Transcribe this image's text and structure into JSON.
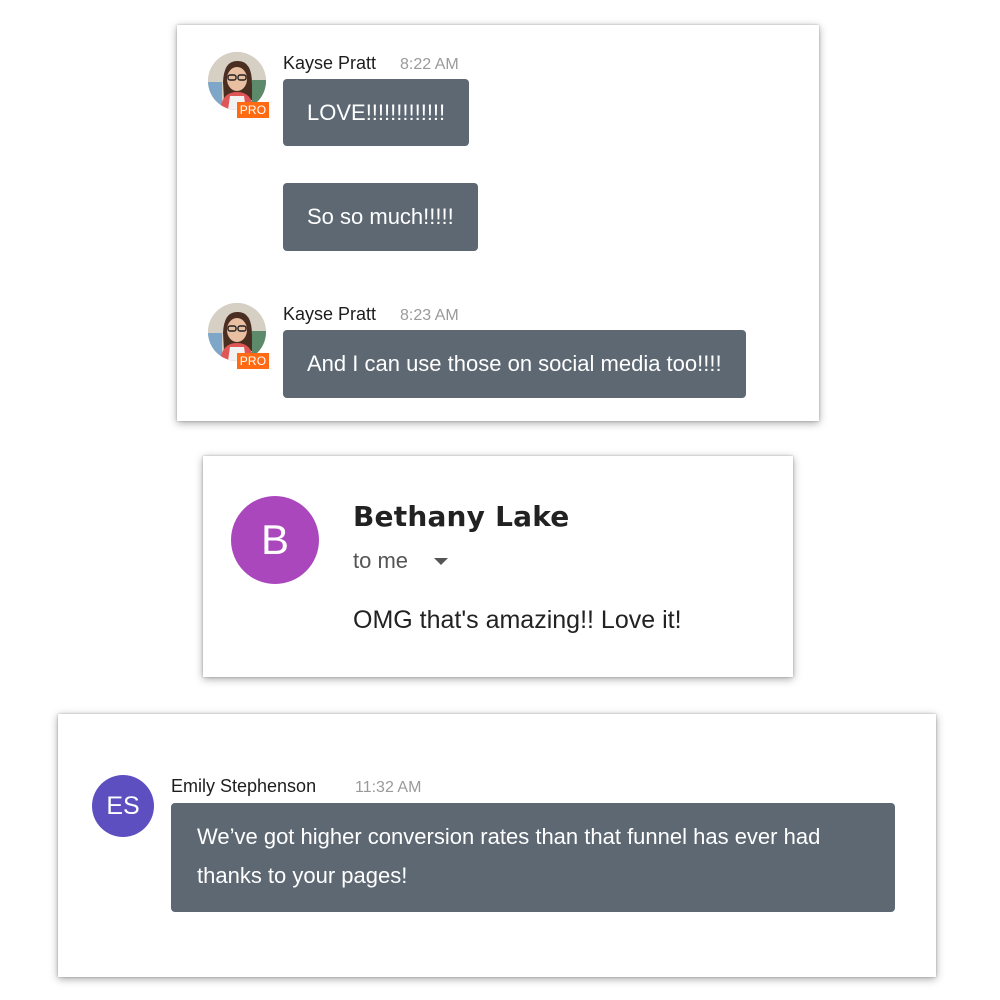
{
  "colors": {
    "bubble": "#5d6873",
    "pro_badge": "#ff6a13",
    "bethany_avatar": "#ab47bc",
    "emily_avatar": "#5e4fc0"
  },
  "chat1": {
    "groups": [
      {
        "sender": "Kayse Pratt",
        "time": "8:22 AM",
        "badge": "PRO",
        "messages": [
          "LOVE!!!!!!!!!!!!!",
          "So so much!!!!!"
        ]
      },
      {
        "sender": "Kayse Pratt",
        "time": "8:23 AM",
        "badge": "PRO",
        "messages": [
          "And I can use those on social media too!!!!"
        ]
      }
    ]
  },
  "email": {
    "avatar_letter": "B",
    "sender": "Bethany Lake",
    "recipient": "to me",
    "body": "OMG that's amazing!! Love it!"
  },
  "chat2": {
    "avatar_initials": "ES",
    "sender": "Emily Stephenson",
    "time": "11:32 AM",
    "message": "We’ve got higher conversion rates than that funnel has ever had thanks to your pages!"
  }
}
